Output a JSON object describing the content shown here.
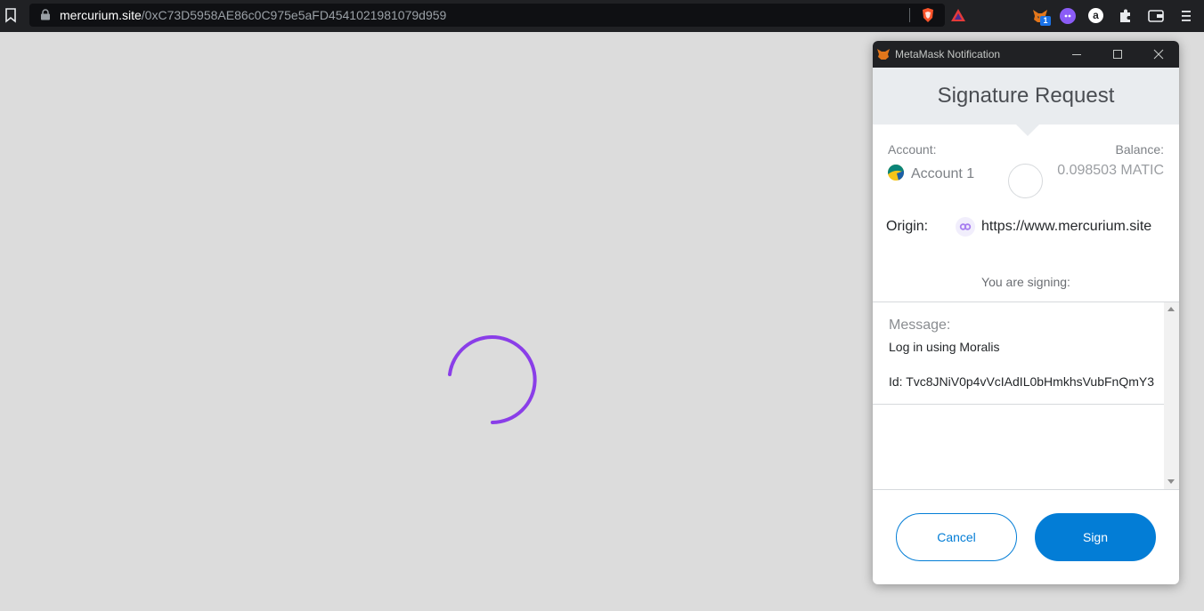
{
  "browser": {
    "url_host": "mercurium.site",
    "url_path": "/0xC73D5958AE86c0C975e5aFD4541021981079d959",
    "extensions": [
      {
        "name": "metamask-fox-icon",
        "badge": "1"
      },
      {
        "name": "ghost-icon"
      },
      {
        "name": "a-icon",
        "glyph": "a"
      },
      {
        "name": "puzzle-icon"
      },
      {
        "name": "wallet-icon"
      },
      {
        "name": "menu-icon"
      }
    ]
  },
  "page": {
    "spinner_color": "#8a3ee8"
  },
  "metamask": {
    "window_title": "MetaMask Notification",
    "heading": "Signature Request",
    "account_label": "Account:",
    "account_name": "Account 1",
    "balance_label": "Balance:",
    "balance_value": "0.098503 MATIC",
    "origin_label": "Origin:",
    "origin_url": "https://www.mercurium.site",
    "signing_label": "You are signing:",
    "message_heading": "Message:",
    "message_line1": "Log in using Moralis",
    "message_line2": "Id: Tvc8JNiV0p4vVcIAdIL0bHmkhsVubFnQmY3",
    "cancel_label": "Cancel",
    "sign_label": "Sign",
    "accent_color": "#037dd6"
  }
}
